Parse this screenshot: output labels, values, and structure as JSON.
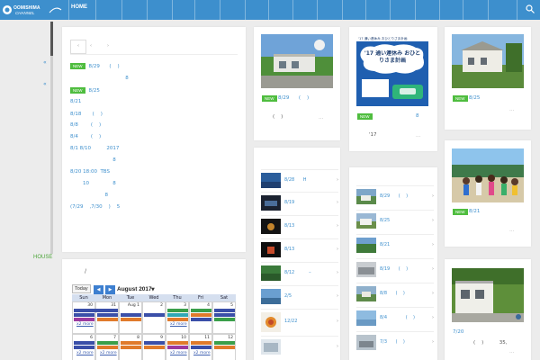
{
  "nav": {
    "home_label": "HOME",
    "logo_text": "OOMISHIMA CHANNEL"
  },
  "sidebar": {
    "marks": [
      "«",
      "«"
    ],
    "house_link": "HOUSE"
  },
  "news": {
    "pager": [
      "‹",
      "‹",
      "›"
    ],
    "lines": [
      {
        "new": true,
        "text": "8/29      (    )"
      },
      {
        "new": false,
        "text": "                                   8"
      },
      {
        "new": true,
        "text": "8/25"
      },
      {
        "new": false,
        "text": "8/21"
      },
      {
        "new": false,
        "text": "8/18       (    )"
      },
      {
        "new": false,
        "text": "8/8        (    )"
      },
      {
        "new": false,
        "text": "8/4        (    )"
      },
      {
        "new": false,
        "text": "8/1 8/10          2017"
      },
      {
        "new": false,
        "text": "                           8"
      },
      {
        "new": false,
        "text": "8/20 18:00  TBS"
      },
      {
        "new": false,
        "text": "        10               8"
      },
      {
        "new": false,
        "text": "                      8"
      },
      {
        "new": false,
        "text": "(7/29    ,7/30    )    5"
      }
    ],
    "new_label": "NEW"
  },
  "posts": [
    {
      "date": "8/29      (    )",
      "text": "(    )",
      "dots": "…",
      "new": true
    },
    {
      "date": "8",
      "text": "'17",
      "dots": "…",
      "new": true
    },
    {
      "date": "8/25",
      "text": "",
      "dots": "…",
      "new": true
    },
    {
      "date": "8/21",
      "text": "",
      "dots": "…",
      "new": true
    },
    {
      "date": "7/20",
      "text": "(    )          35,",
      "dots": "…",
      "new": false
    }
  ],
  "poster": {
    "title": "'17 通い連休み おひとりさま計画",
    "small": "'17 通い連休み おひとりさま計画"
  },
  "list_a": [
    {
      "date": "8/28      H"
    },
    {
      "date": "8/19"
    },
    {
      "date": "8/13"
    },
    {
      "date": "8/13"
    },
    {
      "date": "8/12          –"
    },
    {
      "date": "2/5"
    },
    {
      "date": "12/22"
    },
    {
      "date": ""
    }
  ],
  "list_b": [
    {
      "date": "8/29      (    )"
    },
    {
      "date": "8/25"
    },
    {
      "date": "8/21"
    },
    {
      "date": "8/19      (    )"
    },
    {
      "date": "8/8      (    )"
    },
    {
      "date": "8/4             (    )"
    },
    {
      "date": "7/3      (    )"
    }
  ],
  "calendar": {
    "intro": "/",
    "today": "Today",
    "prev": "◀",
    "next": "▶",
    "month": "August 2017",
    "days": [
      "Sun",
      "Mon",
      "Tue",
      "Wed",
      "Thu",
      "Fri",
      "Sat"
    ],
    "week1": [
      "30",
      "31",
      "Aug 1",
      "2",
      "3",
      "4",
      "5"
    ],
    "week2": [
      "6",
      "7",
      "8",
      "9",
      "10",
      "11",
      "12"
    ],
    "more": "x2 more"
  },
  "colors": {
    "nav": "#3d8fcd",
    "new_badge": "#4fbd3f",
    "link": "#3d8fcd"
  }
}
